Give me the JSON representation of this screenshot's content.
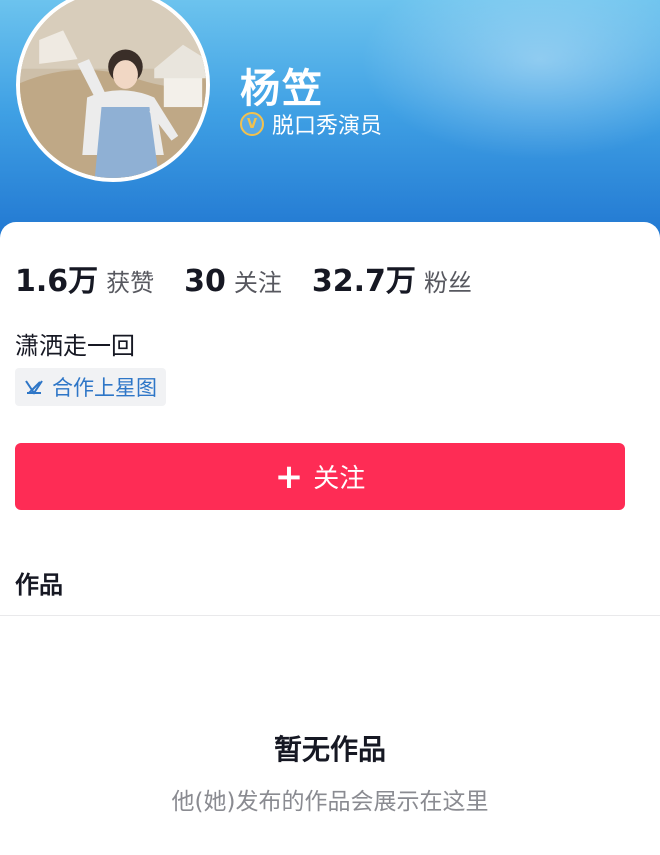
{
  "profile": {
    "name": "杨笠",
    "verify_icon": "verified-v-icon",
    "verify_text": "脱口秀演员",
    "bio": "潇洒走一回",
    "tag": {
      "icon": "star-map-icon",
      "label": "合作上星图"
    }
  },
  "stats": [
    {
      "value": "1.6万",
      "label": "获赞"
    },
    {
      "value": "30",
      "label": "关注"
    },
    {
      "value": "32.7万",
      "label": "粉丝"
    }
  ],
  "follow_button": {
    "icon": "plus-icon",
    "label": "关注"
  },
  "works": {
    "section_title": "作品",
    "empty_title": "暂无作品",
    "empty_subtitle": "他(她)发布的作品会展示在这里"
  },
  "colors": {
    "accent": "#fe2c55",
    "header_blue": "#3fa0e4",
    "tag_text": "#2e76c7",
    "verify_gold": "#f2c14e"
  }
}
